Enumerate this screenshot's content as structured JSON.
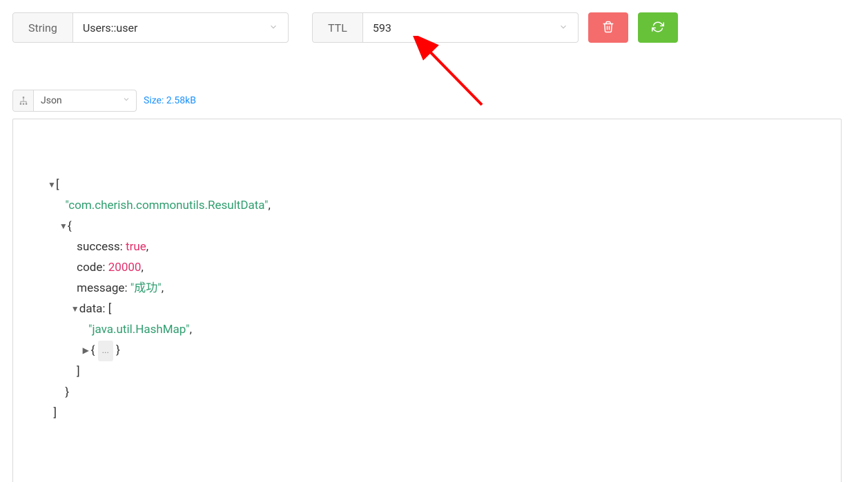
{
  "toolbar": {
    "type_label": "String",
    "key_value": "Users::user",
    "ttl_label": "TTL",
    "ttl_value": "593"
  },
  "viewer": {
    "mode": "Json",
    "size_label": "Size: 2.58kB"
  },
  "json": {
    "root_open": "[",
    "item0": "\"com.cherish.commonutils.ResultData\"",
    "obj_open": "{",
    "k_success": "success:",
    "v_success": "true",
    "k_code": "code:",
    "v_code": "20000",
    "k_message": "message:",
    "v_message": "\"成功\"",
    "k_data": "data:",
    "data_open": "[",
    "data_item0": "\"java.util.HashMap\"",
    "data_nested": "{",
    "data_nested_ellipsis": "...",
    "data_nested_close": "}",
    "data_close": "]",
    "obj_close": "}",
    "root_close": "]"
  }
}
